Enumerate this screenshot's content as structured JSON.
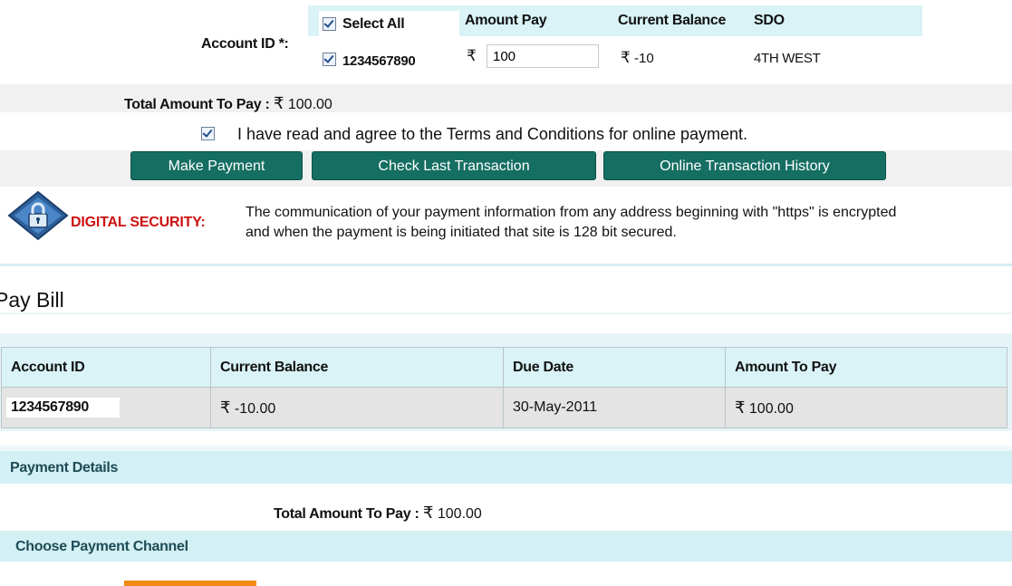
{
  "account_select": {
    "label": "Account ID *:",
    "select_all_label": "Select All",
    "select_all_checked": true,
    "headers": {
      "amount_pay": "Amount Pay",
      "current_balance": "Current Balance",
      "sdo": "SDO"
    },
    "row": {
      "account_id": "1234567890",
      "checked": true,
      "currency_symbol": "₹",
      "amount_value": "100",
      "balance_symbol": "₹",
      "balance": "-10",
      "sdo": "4TH WEST"
    }
  },
  "total_top": {
    "label": "Total Amount To Pay :",
    "currency_symbol": "₹",
    "value": "100.00"
  },
  "terms": {
    "checked": true,
    "text": "I have read and agree to the Terms and Conditions for online payment."
  },
  "buttons": {
    "make_payment": "Make Payment",
    "check_last": "Check Last Transaction",
    "history": "Online Transaction History"
  },
  "security": {
    "label": "DIGITAL SECURITY:",
    "line1": "The communication of your payment information from any address beginning with \"https\" is encrypted",
    "line2": "and when the payment is being initiated that site is 128 bit secured."
  },
  "pay_bill": {
    "title": "Pay Bill",
    "columns": [
      "Account ID",
      "Current Balance",
      "Due Date",
      "Amount To Pay"
    ],
    "row": {
      "account_id": "1234567890",
      "balance_symbol": "₹",
      "balance": "-10.00",
      "due_date": "30-May-2011",
      "amount_symbol": "₹",
      "amount": "100.00"
    }
  },
  "payment_details": {
    "title": "Payment Details",
    "total_label": "Total Amount To Pay :",
    "currency_symbol": "₹",
    "total_value": "100.00",
    "channel_title": "Choose Payment Channel"
  },
  "colors": {
    "button_bg": "#156e62",
    "header_bg": "#d9f3f7",
    "security_label": "#cc1111",
    "accent_orange": "#f08a14"
  },
  "icons": {
    "security": "padlock-shield-icon",
    "checkbox": "checkbox-checked-icon"
  }
}
